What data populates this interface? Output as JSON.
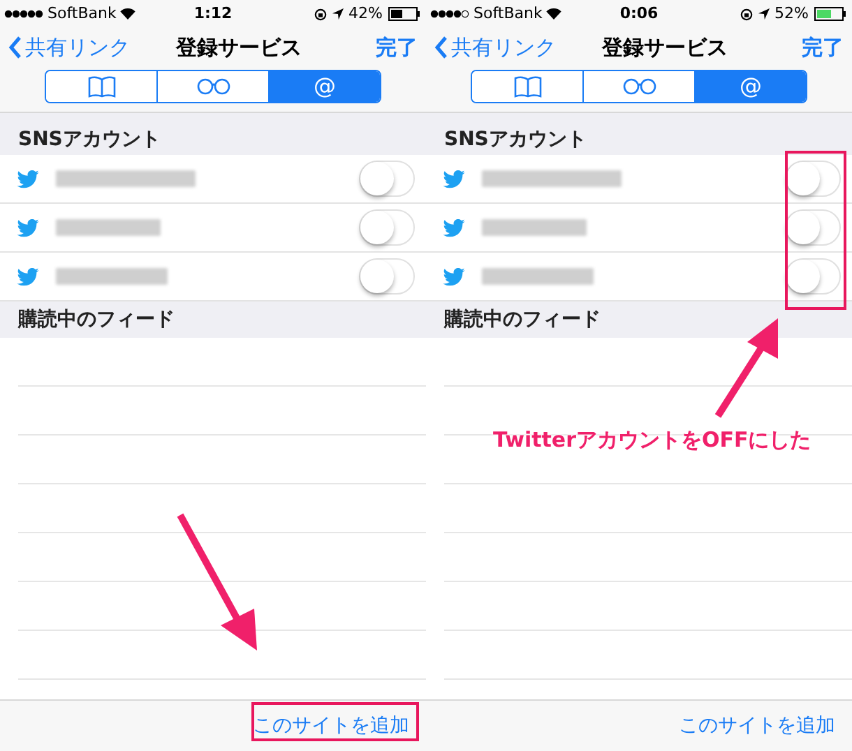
{
  "panels": [
    {
      "status_bar": {
        "carrier": "SoftBank",
        "time": "1:12",
        "battery": "42%"
      },
      "nav": {
        "back": "共有リンク",
        "title": "登録サービス",
        "done": "完了"
      },
      "segments": [
        {
          "kind": "book",
          "selected": false
        },
        {
          "kind": "glasses",
          "selected": false
        },
        {
          "kind": "text",
          "label": "@",
          "selected": true
        }
      ],
      "sns_header": "SNSアカウント",
      "accounts": [
        {
          "on": false
        },
        {
          "on": false
        },
        {
          "on": false
        }
      ],
      "feed_header": "購読中のフィード",
      "add_button": "このサイトを追加",
      "annotation": {
        "kind": "add-button"
      }
    },
    {
      "status_bar": {
        "carrier": "SoftBank",
        "time": "0:06",
        "battery": "52%"
      },
      "nav": {
        "back": "共有リンク",
        "title": "登録サービス",
        "done": "完了"
      },
      "segments": [
        {
          "kind": "book",
          "selected": false
        },
        {
          "kind": "glasses",
          "selected": false
        },
        {
          "kind": "text",
          "label": "@",
          "selected": true
        }
      ],
      "sns_header": "SNSアカウント",
      "accounts": [
        {
          "on": false
        },
        {
          "on": false
        },
        {
          "on": false
        }
      ],
      "feed_header": "購読中のフィード",
      "add_button": "このサイトを追加",
      "annotation": {
        "kind": "switches",
        "caption": "TwitterアカウントをOFFにした"
      }
    }
  ]
}
